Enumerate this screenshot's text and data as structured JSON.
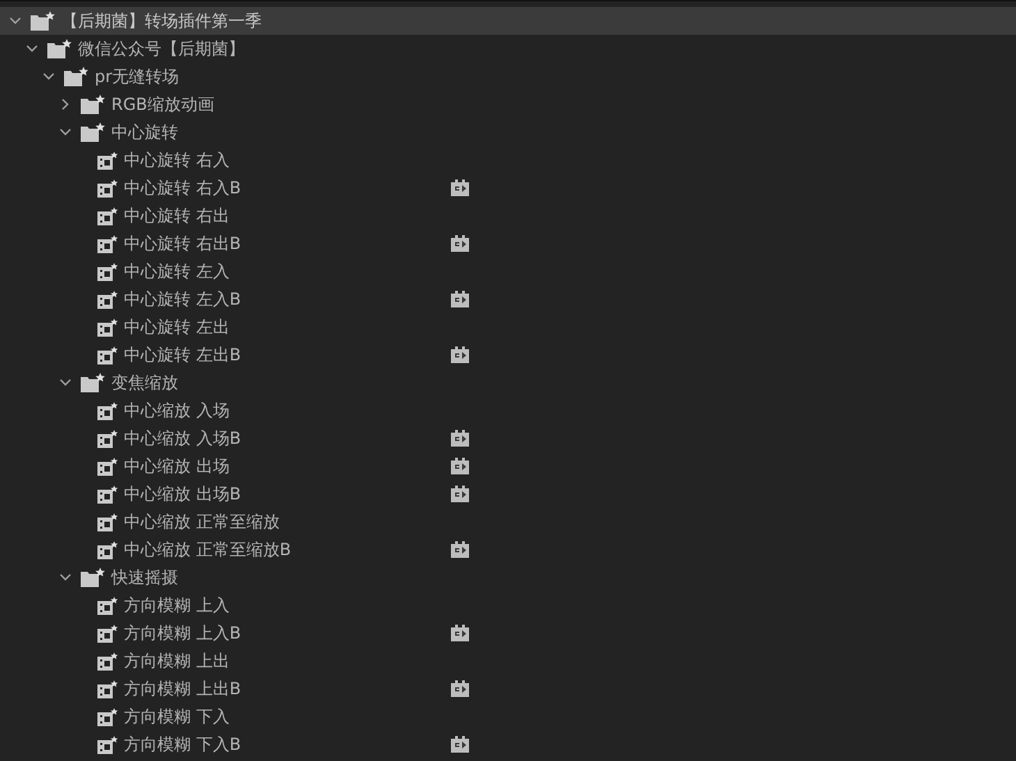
{
  "tree": [
    {
      "kind": "folder",
      "label": "【后期菌】转场插件第一季",
      "expanded": true,
      "selected": true,
      "children": [
        {
          "kind": "folder",
          "label": "微信公众号【后期菌】",
          "expanded": true,
          "selected": false,
          "children": [
            {
              "kind": "folder",
              "label": "pr无缝转场",
              "expanded": true,
              "selected": false,
              "children": [
                {
                  "kind": "folder",
                  "label": "RGB缩放动画",
                  "expanded": false,
                  "selected": false
                },
                {
                  "kind": "folder",
                  "label": "中心旋转",
                  "expanded": true,
                  "selected": false,
                  "children": [
                    {
                      "kind": "preset",
                      "label": "中心旋转 右入",
                      "badge": false,
                      "selected": false
                    },
                    {
                      "kind": "preset",
                      "label": "中心旋转 右入B",
                      "badge": true,
                      "selected": false
                    },
                    {
                      "kind": "preset",
                      "label": "中心旋转 右出",
                      "badge": false,
                      "selected": false
                    },
                    {
                      "kind": "preset",
                      "label": "中心旋转 右出B",
                      "badge": true,
                      "selected": false
                    },
                    {
                      "kind": "preset",
                      "label": "中心旋转 左入",
                      "badge": false,
                      "selected": false
                    },
                    {
                      "kind": "preset",
                      "label": "中心旋转 左入B",
                      "badge": true,
                      "selected": false
                    },
                    {
                      "kind": "preset",
                      "label": "中心旋转 左出",
                      "badge": false,
                      "selected": false
                    },
                    {
                      "kind": "preset",
                      "label": "中心旋转 左出B",
                      "badge": true,
                      "selected": false
                    }
                  ]
                },
                {
                  "kind": "folder",
                  "label": "变焦缩放",
                  "expanded": true,
                  "selected": false,
                  "children": [
                    {
                      "kind": "preset",
                      "label": "中心缩放 入场",
                      "badge": false,
                      "selected": false
                    },
                    {
                      "kind": "preset",
                      "label": "中心缩放 入场B",
                      "badge": true,
                      "selected": false
                    },
                    {
                      "kind": "preset",
                      "label": "中心缩放 出场",
                      "badge": true,
                      "selected": false
                    },
                    {
                      "kind": "preset",
                      "label": "中心缩放 出场B",
                      "badge": true,
                      "selected": false
                    },
                    {
                      "kind": "preset",
                      "label": "中心缩放 正常至缩放",
                      "badge": false,
                      "selected": false
                    },
                    {
                      "kind": "preset",
                      "label": "中心缩放 正常至缩放B",
                      "badge": true,
                      "selected": false
                    }
                  ]
                },
                {
                  "kind": "folder",
                  "label": "快速摇摄",
                  "expanded": true,
                  "selected": false,
                  "children": [
                    {
                      "kind": "preset",
                      "label": "方向模糊 上入",
                      "badge": false,
                      "selected": false
                    },
                    {
                      "kind": "preset",
                      "label": "方向模糊 上入B",
                      "badge": true,
                      "selected": false
                    },
                    {
                      "kind": "preset",
                      "label": "方向模糊 上出",
                      "badge": false,
                      "selected": false
                    },
                    {
                      "kind": "preset",
                      "label": "方向模糊 上出B",
                      "badge": true,
                      "selected": false
                    },
                    {
                      "kind": "preset",
                      "label": "方向模糊 下入",
                      "badge": false,
                      "selected": false
                    },
                    {
                      "kind": "preset",
                      "label": "方向模糊 下入B",
                      "badge": true,
                      "selected": false
                    }
                  ]
                }
              ]
            }
          ]
        }
      ]
    }
  ]
}
